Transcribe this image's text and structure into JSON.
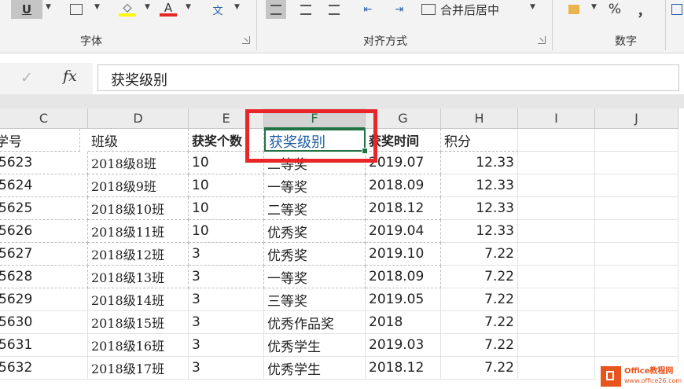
{
  "ribbon": {
    "underline_label": "U",
    "fill_glyph": "◇",
    "font_color_glyph": "A",
    "phonetic_glyph": "文",
    "merge_label": "合并后居中",
    "percent_label": "%",
    "comma_label": "，",
    "groups": {
      "font": "字体",
      "alignment": "对齐方式",
      "number": "数字"
    },
    "colors": {
      "underline_active": "#c5c5c5",
      "fill_bar": "#ffff00",
      "font_bar": "#e8262a"
    }
  },
  "formula_bar": {
    "check_glyph": "✓",
    "fx_label": "fx",
    "value": "获奖级别"
  },
  "columns": [
    "C",
    "D",
    "E",
    "F",
    "G",
    "H",
    "I",
    "J"
  ],
  "selected_column": "F",
  "header_row": [
    "学号",
    "班级",
    "获奖个数",
    "获奖级别",
    "获奖时间",
    "积分"
  ],
  "rows": [
    [
      "5623",
      "2018级8班",
      "10",
      "二等奖",
      "2019.07",
      "12.33"
    ],
    [
      "5624",
      "2018级9班",
      "10",
      "一等奖",
      "2018.09",
      "12.33"
    ],
    [
      "5625",
      "2018级10班",
      "10",
      "二等奖",
      "2018.12",
      "12.33"
    ],
    [
      "5626",
      "2018级11班",
      "10",
      "优秀奖",
      "2019.04",
      "12.33"
    ],
    [
      "5627",
      "2018级12班",
      "3",
      "优秀奖",
      "2019.10",
      "7.22"
    ],
    [
      "5628",
      "2018级13班",
      "3",
      "一等奖",
      "2018.09",
      "7.22"
    ],
    [
      "5629",
      "2018级14班",
      "3",
      "三等奖",
      "2019.05",
      "7.22"
    ],
    [
      "5630",
      "2018级15班",
      "3",
      "优秀作品奖",
      "2018",
      "7.22"
    ],
    [
      "5631",
      "2018级16班",
      "3",
      "优秀学生",
      "2019.03",
      "7.22"
    ],
    [
      "5632",
      "2018级17班",
      "3",
      "优秀学生",
      "2018.12",
      "7.22"
    ]
  ],
  "watermark": {
    "name": "Office教程网",
    "url": "www.office26.com"
  },
  "accent_color": "#217346",
  "highlight_color": "#e8262a"
}
